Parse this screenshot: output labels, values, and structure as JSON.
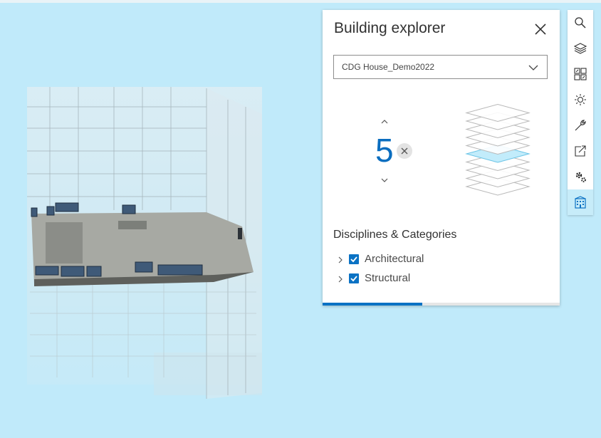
{
  "panel": {
    "title": "Building explorer",
    "selected_model": "CDG House_Demo2022",
    "level": "5",
    "section_title": "Disciplines & Categories",
    "disciplines": [
      {
        "label": "Architectural",
        "checked": true
      },
      {
        "label": "Structural",
        "checked": true
      }
    ],
    "progress_fraction": 0.42
  },
  "toolbar": {
    "tools": [
      {
        "icon": "search-icon"
      },
      {
        "icon": "layers-icon"
      },
      {
        "icon": "basemap-gallery-icon"
      },
      {
        "icon": "daylight-icon"
      },
      {
        "icon": "wrench-icon"
      },
      {
        "icon": "share-icon"
      },
      {
        "icon": "gears-icon"
      },
      {
        "icon": "building-icon",
        "active": true
      }
    ]
  },
  "colors": {
    "accent": "#0a72c4",
    "sky": "#c0eafa",
    "active_tool_bg": "#c7ecf9"
  }
}
